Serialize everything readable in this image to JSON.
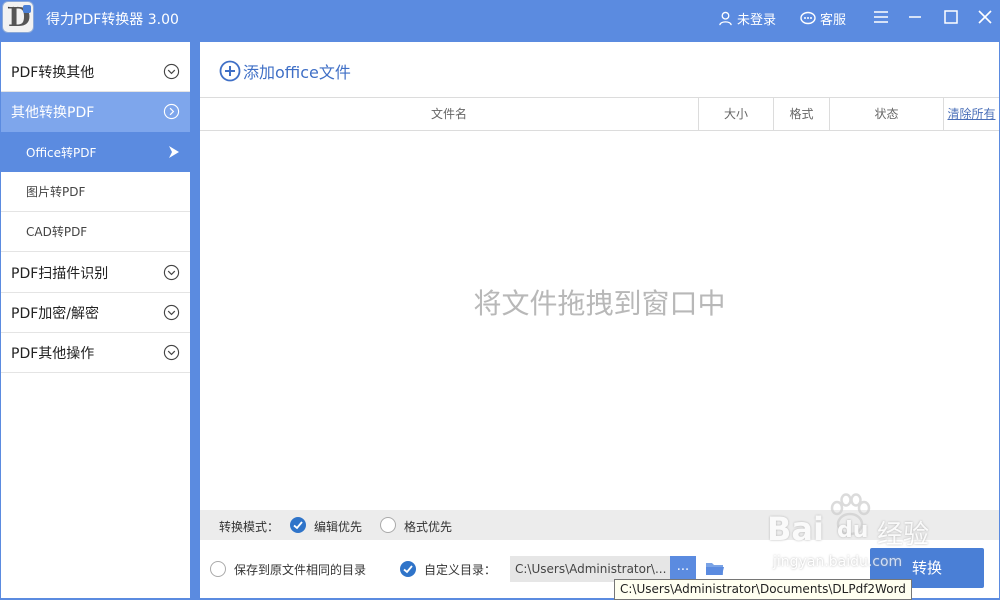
{
  "titlebar": {
    "app_title": "得力PDF转换器 3.00",
    "logo_letter": "D",
    "login_label": "未登录",
    "service_label": "客服"
  },
  "sidebar": {
    "groups": [
      {
        "label": "PDF转换其他"
      },
      {
        "label": "其他转换PDF"
      },
      {
        "label": "PDF扫描件识别"
      },
      {
        "label": "PDF加密/解密"
      },
      {
        "label": "PDF其他操作"
      }
    ],
    "subitems": [
      {
        "label": "Office转PDF"
      },
      {
        "label": "图片转PDF"
      },
      {
        "label": "CAD转PDF"
      }
    ]
  },
  "main": {
    "add_button_label": "添加office文件",
    "columns": {
      "filename": "文件名",
      "size": "大小",
      "format": "格式",
      "status": "状态",
      "clear_all": "清除所有"
    },
    "drop_hint": "将文件拖拽到窗口中",
    "mode": {
      "label": "转换模式：",
      "options": [
        "编辑优先",
        "格式优先"
      ],
      "selected": "编辑优先"
    },
    "output": {
      "same_dir_label": "保存到原文件相同的目录",
      "custom_dir_label": "自定义目录：",
      "path_value": "C:\\Users\\Administrator\\...",
      "browse_label": "...",
      "convert_label": "转换",
      "tooltip": "C:\\Users\\Administrator\\Documents\\DLPdf2Word"
    }
  },
  "watermark": {
    "brand_left": "Bai",
    "brand_right": "du",
    "brand_cn": "经验",
    "url": "jingyan.baidu.com"
  },
  "colors": {
    "accent": "#5b8be0",
    "sidebar_active": "#7ea6ec",
    "check": "#2f74c9",
    "hint": "#b8b8b8"
  }
}
